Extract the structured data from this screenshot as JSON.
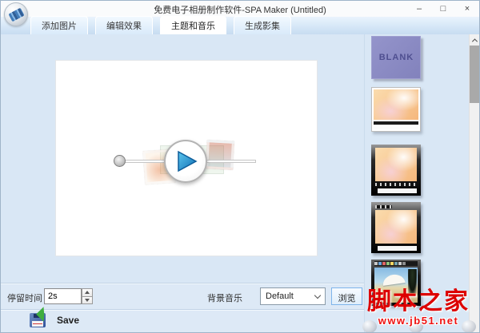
{
  "window": {
    "title": "免费电子相册制作软件-SPA Maker (Untitled)",
    "minimize": "–",
    "maximize": "□",
    "close": "×"
  },
  "tabs": [
    {
      "label": "添加图片",
      "active": false
    },
    {
      "label": "编辑效果",
      "active": false
    },
    {
      "label": "主题和音乐",
      "active": true
    },
    {
      "label": "生成影集",
      "active": false
    }
  ],
  "theme_panel": {
    "blank_label": "BLANK",
    "items": [
      {
        "name": "blank",
        "label": "BLANK"
      },
      {
        "name": "flower-theme-light"
      },
      {
        "name": "flower-theme-dark-controls-bottom"
      },
      {
        "name": "flower-theme-dark-controls-top"
      },
      {
        "name": "beach-theme-toolbar"
      }
    ]
  },
  "controls": {
    "stay_time_label": "停留时间",
    "stay_time_value": "2s",
    "bg_music_label": "背景音乐",
    "bg_music_value": "Default",
    "browse_label": "浏览"
  },
  "save": {
    "label": "Save"
  },
  "watermark": {
    "site_name": "脚本之家",
    "site_url": "www.jb51.net"
  },
  "colors": {
    "panel_blue": "#d9e7f5",
    "tabstrip_blue": "#cfe2f4",
    "blank_purple": "#8a8ac2",
    "play_blue": "#1d86c8",
    "watermark_red": "#dd0000"
  }
}
